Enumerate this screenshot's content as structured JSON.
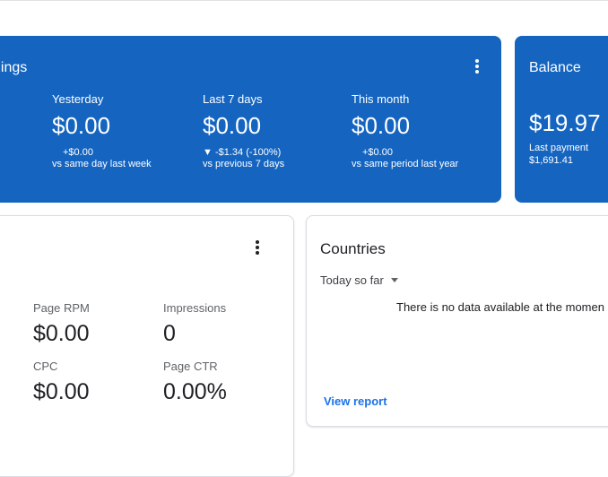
{
  "earnings": {
    "title": "nings",
    "periods": [
      {
        "label": "Yesterday",
        "value": "$0.00",
        "delta": "+$0.00",
        "compare": "vs same day last week"
      },
      {
        "label": "Last 7 days",
        "value": "$0.00",
        "delta": "▼ -$1.34 (-100%)",
        "compare": "vs previous 7 days"
      },
      {
        "label": "This month",
        "value": "$0.00",
        "delta": "+$0.00",
        "compare": "vs same period last year"
      }
    ]
  },
  "balance": {
    "title": "Balance",
    "amount": "$19.97",
    "last_payment_label": "Last payment",
    "last_payment_value": "$1,691.41"
  },
  "metrics": {
    "items": [
      {
        "label": "Page RPM",
        "value": "$0.00"
      },
      {
        "label": "Impressions",
        "value": "0"
      },
      {
        "label": "CPC",
        "value": "$0.00"
      },
      {
        "label": "Page CTR",
        "value": "0.00%"
      }
    ]
  },
  "countries": {
    "title": "Countries",
    "range": "Today so far",
    "empty_message": "There is no data available at the momen",
    "view_report": "View report"
  },
  "colors": {
    "card_blue": "#1565c0",
    "link_blue": "#1a73e8",
    "border": "#dadce0"
  },
  "icons": {
    "kebab": "more-vert-icon",
    "dropdown": "caret-down-icon"
  }
}
